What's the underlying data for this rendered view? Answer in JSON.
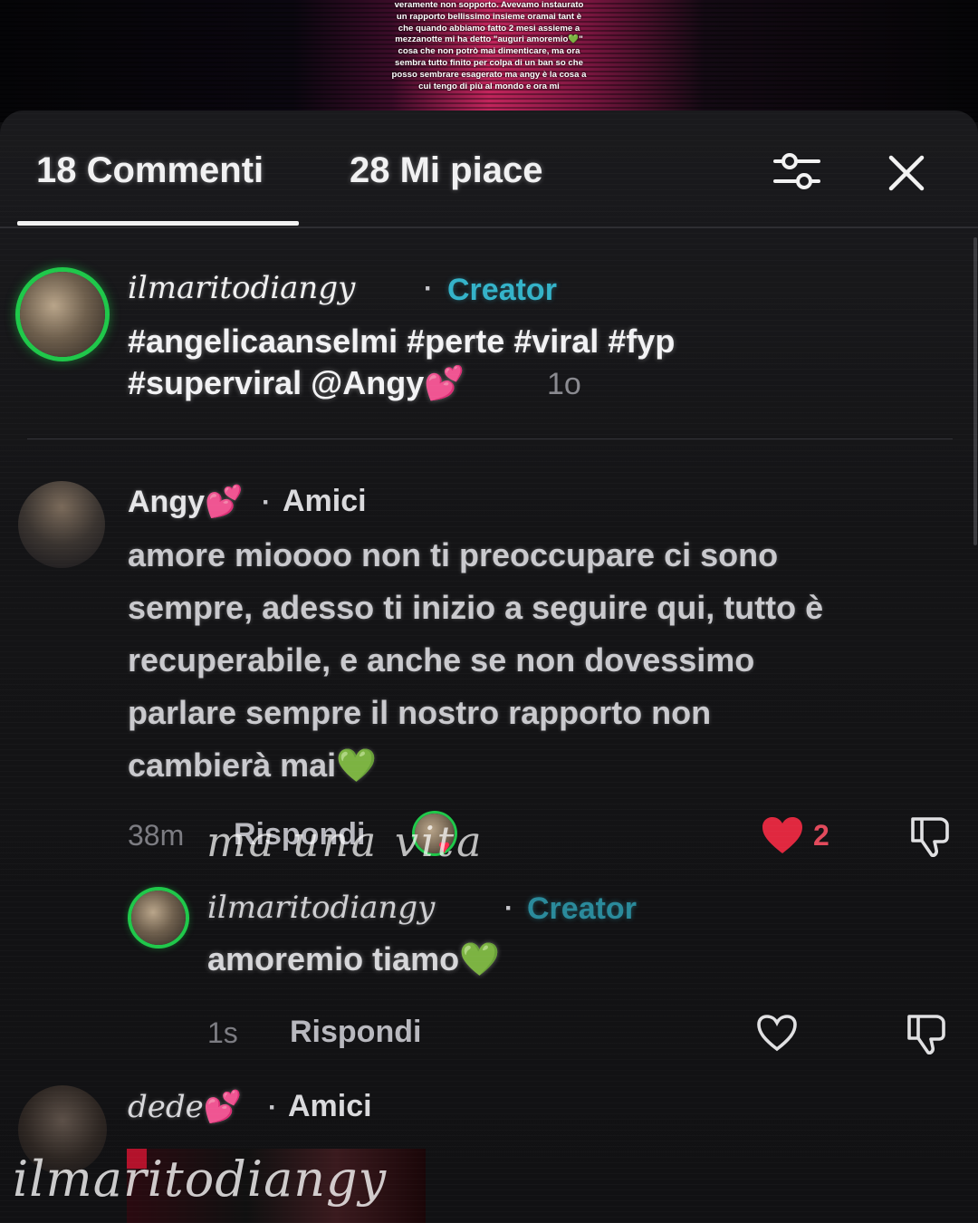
{
  "video": {
    "caption": "veramente non sopporto. Avevamo instaurato un rapporto bellissimo insieme oramai tant è che quando abbiamo fatto 2 mesi assieme a mezzanotte mi ha detto \"auguri amoremio💚\" cosa che non potrò mai dimenticare, ma ora sembra tutto finito per colpa di un ban so che posso sembrare esagerato ma angy è la cosa a cui tengo di più al mondo e ora mi"
  },
  "header": {
    "tab_comments": "18 Commenti",
    "tab_likes": "28 Mi piace",
    "filter_icon": "sliders-icon",
    "close_icon": "close-icon"
  },
  "comments": [
    {
      "username": "ilmaritodiangy",
      "separator": "·",
      "badge": "Creator",
      "text_line1": "#angelicaanselmi #perte #viral #fyp",
      "text_line2": "#superviral @Angy",
      "emoji": "💕",
      "time": "1o"
    },
    {
      "username": "Angy",
      "username_emoji": "💕",
      "separator": "·",
      "badge": "Amici",
      "lines": [
        "amore mioooo non ti preoccupare ci sono",
        "sempre, adesso ti inizio a seguire qui, tutto è",
        "recuperabile, e anche se non dovessimo",
        "parlare sempre il nostro rapporto non",
        "cambierà mai"
      ],
      "end_emoji": "💚",
      "time": "38m",
      "reply_label": "Rispondi",
      "like_count": "2",
      "reply": {
        "username": "ilmaritodiangy",
        "separator": "·",
        "badge": "Creator",
        "text": "amoremio tiamo",
        "emoji": "💚",
        "time": "1s",
        "reply_label": "Rispondi"
      }
    },
    {
      "username": "dede",
      "username_emoji": "💕",
      "separator": "·",
      "badge": "Amici"
    }
  ],
  "overlay": {
    "lyric": "ma una vita",
    "watermark": "ilmaritodiangy"
  },
  "colors": {
    "creator_badge": "#34b3c9",
    "like_red": "#e24a5c",
    "ring_green": "#1fc84a"
  }
}
